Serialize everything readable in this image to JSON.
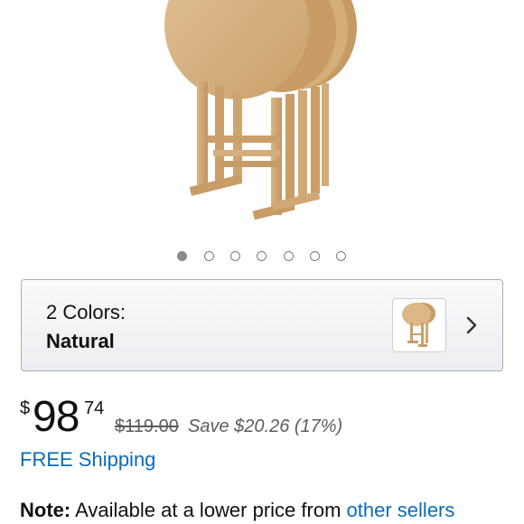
{
  "carousel": {
    "count": 7,
    "active_index": 0
  },
  "variation": {
    "label": "2 Colors:",
    "value": "Natural",
    "icons": {
      "thumbnail": "product-thumbnail-icon",
      "chevron": "chevron-right-icon"
    }
  },
  "price": {
    "symbol": "$",
    "whole": "98",
    "fraction": "74",
    "list_price": "$119.00",
    "savings": "Save $20.26 (17%)"
  },
  "shipping": {
    "text": "FREE Shipping"
  },
  "note": {
    "label": "Note:",
    "text": "Available at a lower price from",
    "link": "other sellers"
  },
  "colors": {
    "link": "#0a6cb5",
    "wood": "#d6b07c",
    "dot_active": "#8a8a8a"
  }
}
